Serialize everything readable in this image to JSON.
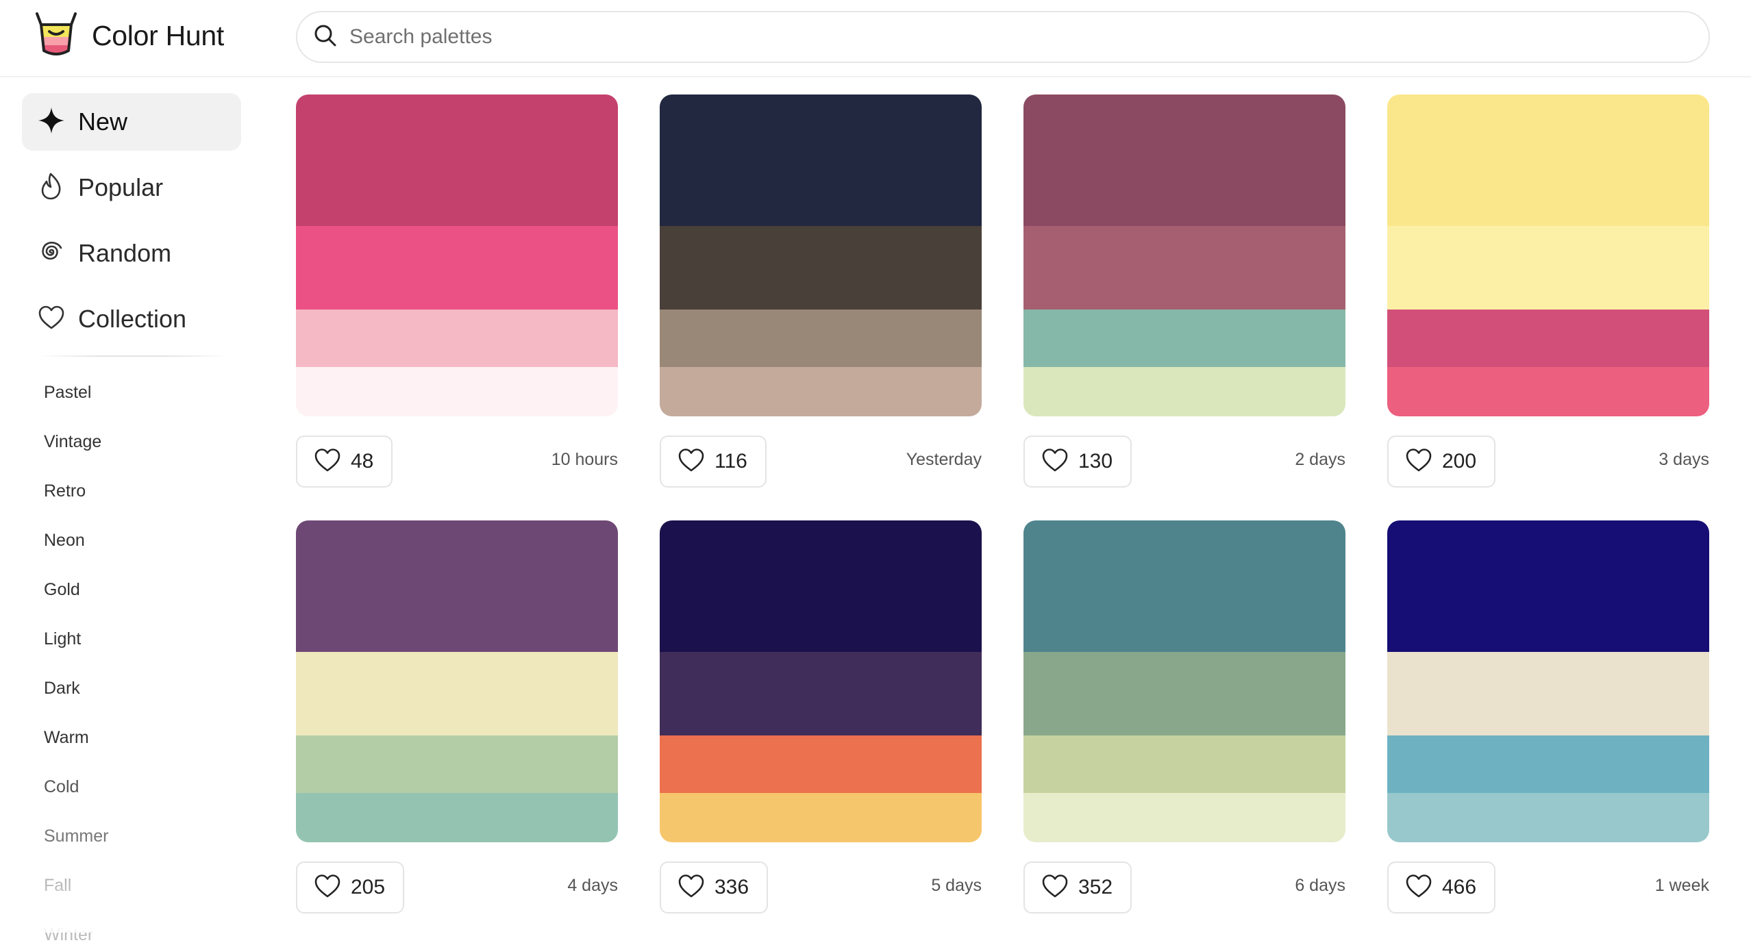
{
  "app": {
    "title": "Color Hunt",
    "logo_colors": {
      "top": "#f3e55a",
      "middle": "#f7a0aa",
      "bottom": "#e85a7a",
      "outline": "#222222"
    }
  },
  "search": {
    "placeholder": "Search palettes",
    "value": "",
    "icon": "search-icon"
  },
  "sidebar": {
    "nav": [
      {
        "label": "New",
        "icon": "sparkle-icon",
        "active": true
      },
      {
        "label": "Popular",
        "icon": "flame-icon",
        "active": false
      },
      {
        "label": "Random",
        "icon": "spiral-icon",
        "active": false
      },
      {
        "label": "Collection",
        "icon": "heart-icon",
        "active": false
      }
    ],
    "tags": [
      "Pastel",
      "Vintage",
      "Retro",
      "Neon",
      "Gold",
      "Light",
      "Dark",
      "Warm",
      "Cold",
      "Summer",
      "Fall",
      "Winter"
    ]
  },
  "palettes": [
    {
      "colors": [
        "#c4416d",
        "#ec5185",
        "#f4b9c5",
        "#fef2f5"
      ],
      "likes": "48",
      "time": "10 hours"
    },
    {
      "colors": [
        "#222840",
        "#4a403a",
        "#998878",
        "#c4aa9b"
      ],
      "likes": "116",
      "time": "Yesterday"
    },
    {
      "colors": [
        "#8b4962",
        "#a55f70",
        "#86b8a9",
        "#dae7bc"
      ],
      "likes": "130",
      "time": "2 days"
    },
    {
      "colors": [
        "#fbe78b",
        "#fcf0a7",
        "#d24f7a",
        "#ec5f7e"
      ],
      "likes": "200",
      "time": "3 days"
    },
    {
      "colors": [
        "#6e4875",
        "#efe8bd",
        "#b3cea6",
        "#94c4b1"
      ],
      "likes": "205",
      "time": "4 days"
    },
    {
      "colors": [
        "#1b114c",
        "#402d59",
        "#ec714f",
        "#f6c66c"
      ],
      "likes": "336",
      "time": "5 days"
    },
    {
      "colors": [
        "#4f848d",
        "#89a78b",
        "#c6d2a0",
        "#e7edcb"
      ],
      "likes": "352",
      "time": "6 days"
    },
    {
      "colors": [
        "#160e74",
        "#ebe2cd",
        "#6eb2c2",
        "#98c8cb"
      ],
      "likes": "466",
      "time": "1 week"
    }
  ]
}
